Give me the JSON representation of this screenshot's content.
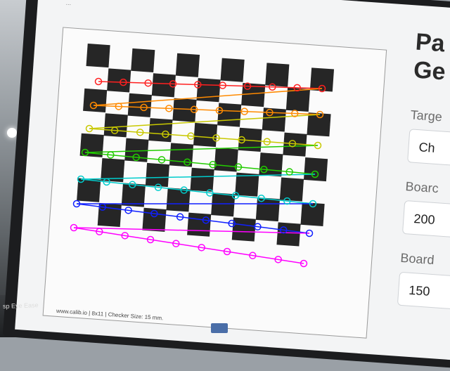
{
  "url_fragment": "...",
  "target_caption": "www.calib.io | 8x11 | Checker Size: 15 mm.",
  "panel": {
    "title_line1": "Pa",
    "title_line2": "Ge",
    "target_label": "Targe",
    "target_value": "Ch",
    "board_width_label": "Boarc",
    "board_width_value": "200",
    "board_height_label": "Board",
    "board_height_value": "150"
  },
  "corner_label": "sp Eye Ease",
  "colors": {
    "row1": "#ff2020",
    "row2": "#ff8a00",
    "row3": "#c8c800",
    "row4": "#22cc00",
    "row5": "#00cccc",
    "row6": "#1020ff",
    "row7": "#ff00ff"
  }
}
